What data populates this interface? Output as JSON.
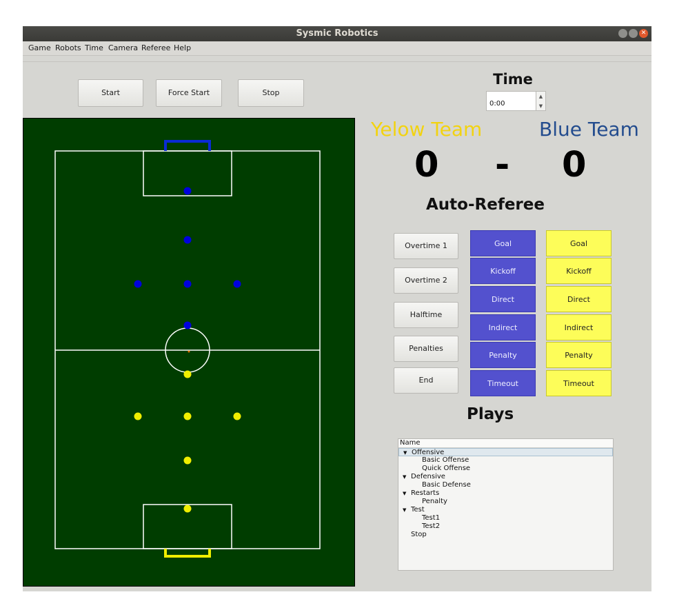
{
  "window": {
    "title": "Sysmic Robotics"
  },
  "menu": [
    "Game",
    "Robots",
    "Time",
    "Camera",
    "Referee",
    "Help"
  ],
  "controls": {
    "start": "Start",
    "force_start": "Force Start",
    "stop": "Stop"
  },
  "time": {
    "label": "Time",
    "value": "0:00"
  },
  "teams": {
    "yellow": "Yelow Team",
    "blue": "Blue Team",
    "yellow_color": "#f2d311",
    "blue_color": "#234c8e"
  },
  "score": {
    "yellow": "0",
    "separator": "-",
    "blue": "0"
  },
  "auto_referee": {
    "title": "Auto-Referee",
    "period_buttons": [
      "Overtime 1",
      "Overtime 2",
      "Halftime",
      "Penalties",
      "End"
    ],
    "blue_buttons": [
      "Goal",
      "Kickoff",
      "Direct",
      "Indirect",
      "Penalty",
      "Timeout"
    ],
    "yellow_buttons": [
      "Goal",
      "Kickoff",
      "Direct",
      "Indirect",
      "Penalty",
      "Timeout"
    ]
  },
  "plays": {
    "title": "Plays",
    "header": "Name",
    "tree": [
      {
        "label": "Offensive",
        "level": 0,
        "expanded": true,
        "selected": true
      },
      {
        "label": "Basic Offense",
        "level": 1
      },
      {
        "label": "Quick Offense",
        "level": 1
      },
      {
        "label": "Defensive",
        "level": 0,
        "expanded": true
      },
      {
        "label": "Basic Defense",
        "level": 1
      },
      {
        "label": "Restarts",
        "level": 0,
        "expanded": true
      },
      {
        "label": "Penalty",
        "level": 1
      },
      {
        "label": "Test",
        "level": 0,
        "expanded": true
      },
      {
        "label": "Test1",
        "level": 1
      },
      {
        "label": "Test2",
        "level": 1
      },
      {
        "label": "Stop",
        "level": 0
      }
    ]
  },
  "field": {
    "colors": {
      "grass": "#003d00",
      "lines": "#ffffff",
      "blue_robot": "#0000dd",
      "yellow_robot": "#f0ee00",
      "ball": "#e07000"
    },
    "blue_robot_count": 6,
    "yellow_robot_count": 6
  }
}
